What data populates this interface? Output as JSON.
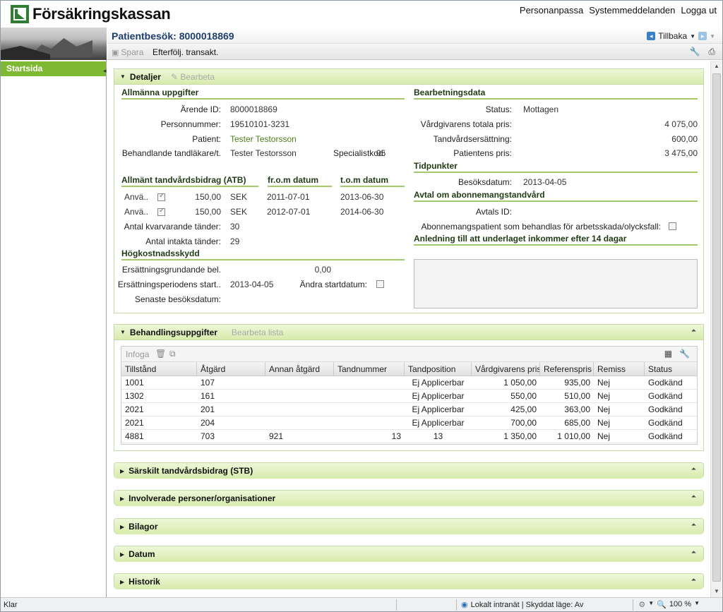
{
  "app": {
    "logo_text": "Försäkringskassan"
  },
  "toplinks": [
    "Personanpassa",
    "Systemmeddelanden",
    "Logga ut"
  ],
  "sidebar": {
    "active_item": "Startsida"
  },
  "header": {
    "title": "Patientbesök: 8000018869",
    "back_label": "Tillbaka"
  },
  "toolbar": {
    "save_label": "Spara",
    "follow_label": "Efterfölj. transakt."
  },
  "details": {
    "title": "Detaljer",
    "edit_label": "Bearbeta",
    "general": {
      "heading": "Allmänna uppgifter",
      "arende_label": "Ärende ID:",
      "arende_value": "8000018869",
      "pnr_label": "Personnummer:",
      "pnr_value": "19510101-3231",
      "patient_label": "Patient:",
      "patient_value": "Tester Testorsson",
      "dentist_label": "Behandlande tandläkare/t.",
      "dentist_value": "Tester Testorsson",
      "spec_label": "Specialistkod:",
      "spec_value": "05"
    },
    "atb": {
      "heading": "Allmänt tandvårdsbidrag (ATB)",
      "from_heading": "fr.o.m datum",
      "to_heading": "t.o.m datum",
      "rows": [
        {
          "label": "Anvä..",
          "amount": "150,00",
          "currency": "SEK",
          "from": "2011-07-01",
          "to": "2013-06-30"
        },
        {
          "label": "Anvä..",
          "amount": "150,00",
          "currency": "SEK",
          "from": "2012-07-01",
          "to": "2014-06-30"
        }
      ],
      "remaining_label": "Antal kvarvarande tänder:",
      "remaining_value": "30",
      "intact_label": "Antal intakta tänder:",
      "intact_value": "29"
    },
    "hkskydd": {
      "heading": "Högkostnadsskydd",
      "base_label": "Ersättningsgrundande bel.",
      "base_value": "0,00",
      "start_label": "Ersättningsperiodens start..",
      "start_value": "2013-04-05",
      "change_label": "Ändra startdatum:",
      "last_label": "Senaste besöksdatum:"
    },
    "processing": {
      "heading": "Bearbetningsdata",
      "status_label": "Status:",
      "status_value": "Mottagen",
      "total_label": "Vårdgivarens totala pris:",
      "total_value": "4 075,00",
      "comp_label": "Tandvårdsersättning:",
      "comp_value": "600,00",
      "patient_price_label": "Patientens pris:",
      "patient_price_value": "3 475,00"
    },
    "times": {
      "heading": "Tidpunkter",
      "visit_label": "Besöksdatum:",
      "visit_value": "2013-04-05"
    },
    "subscription": {
      "heading": "Avtal om abonnemangstandvård",
      "id_label": "Avtals ID:",
      "injury_label": "Abonnemangspatient som behandlas för arbetsskada/olycksfall:"
    },
    "reason": {
      "heading": "Anledning till att underlaget inkommer efter 14 dagar"
    }
  },
  "treatments": {
    "title": "Behandlingsuppgifter",
    "edit_label": "Bearbeta lista",
    "insert_label": "Infoga",
    "columns": [
      "Tillstånd",
      "Åtgärd",
      "Annan åtgärd",
      "Tandnummer",
      "Tandposition",
      "Vårdgivarens pris",
      "Referenspris",
      "Remiss",
      "Status"
    ],
    "rows": [
      [
        "1001",
        "107",
        "",
        "",
        "Ej Applicerbar",
        "1 050,00",
        "935,00",
        "Nej",
        "Godkänd"
      ],
      [
        "1302",
        "161",
        "",
        "",
        "Ej Applicerbar",
        "550,00",
        "510,00",
        "Nej",
        "Godkänd"
      ],
      [
        "2021",
        "201",
        "",
        "",
        "Ej Applicerbar",
        "425,00",
        "363,00",
        "Nej",
        "Godkänd"
      ],
      [
        "2021",
        "204",
        "",
        "",
        "Ej Applicerbar",
        "700,00",
        "685,00",
        "Nej",
        "Godkänd"
      ],
      [
        "4881",
        "703",
        "921",
        "13",
        "13",
        "1 350,00",
        "1 010,00",
        "Nej",
        "Godkänd"
      ]
    ]
  },
  "collapsed_panels": [
    "Särskilt tandvårdsbidrag (STB)",
    "Involverade personer/organisationer",
    "Bilagor",
    "Datum",
    "Historik"
  ],
  "statusbar": {
    "left": "Klar",
    "zone": "Lokalt intranät | Skyddat läge: Av",
    "zoom": "100 %"
  }
}
